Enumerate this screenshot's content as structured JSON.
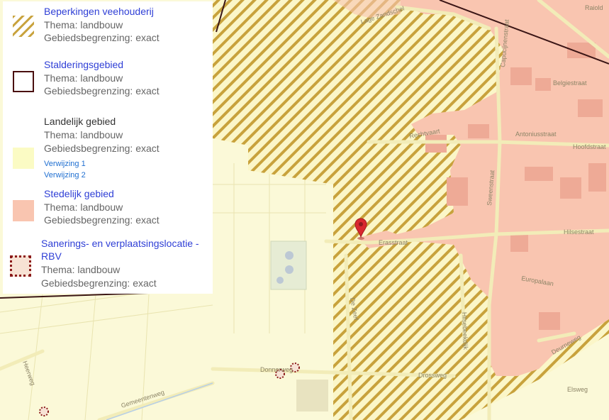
{
  "legend": {
    "entries": [
      {
        "title": "Beperkingen veehouderij",
        "theme": "Thema: landbouw",
        "boundary": "Gebiedsbegrenzing: exact",
        "swatch": "hatch",
        "color": "#c8a23c"
      },
      {
        "title": "Stalderingsgebied",
        "theme": "Thema: landbouw",
        "boundary": "Gebiedsbegrenzing: exact",
        "swatch": "outline",
        "color": "#4a0f0f"
      },
      {
        "title": "Landelijk gebied",
        "theme": "Thema: landbouw",
        "boundary": "Gebiedsbegrenzing: exact",
        "swatch": "fill",
        "color": "#fbfbc4",
        "links": [
          "Verwijzing 1",
          "Verwijzing 2"
        ]
      },
      {
        "title": "Stedelijk gebied",
        "theme": "Thema: landbouw",
        "boundary": "Gebiedsbegrenzing: exact",
        "swatch": "fill",
        "color": "#f9c5b0"
      },
      {
        "title_line1": "Sanerings- en verplaatsingslocatie -",
        "title_line2": "RBV",
        "theme": "Thema: landbouw",
        "boundary": "Gebiedsbegrenzing: exact",
        "swatch": "dashed",
        "color": "#8b1a1a"
      }
    ]
  },
  "map": {
    "colors": {
      "rural": "#fbf9d8",
      "urban": "#f9c5b0",
      "hatch": "#c8a23c",
      "boundary": "#3a1515",
      "road": "#f2ecb8",
      "pin": "#d9282f"
    },
    "streets": [
      "Lage Zandschel",
      "Capucijnenstraat",
      "Belgiestraat",
      "Rechtvaart",
      "Antoniusstraat",
      "Hoofdstraat",
      "Sweenstraat",
      "Hilsestraat",
      "Erasstraat",
      "Europalaan",
      "De Zeef",
      "Donnerweg",
      "Gemeentenweg",
      "Heerweg",
      "Hilsebeekdijk",
      "Deurneweg",
      "Drossweg",
      "Raiold",
      "Elsweg"
    ],
    "marker": {
      "name": "location-pin-icon"
    }
  }
}
